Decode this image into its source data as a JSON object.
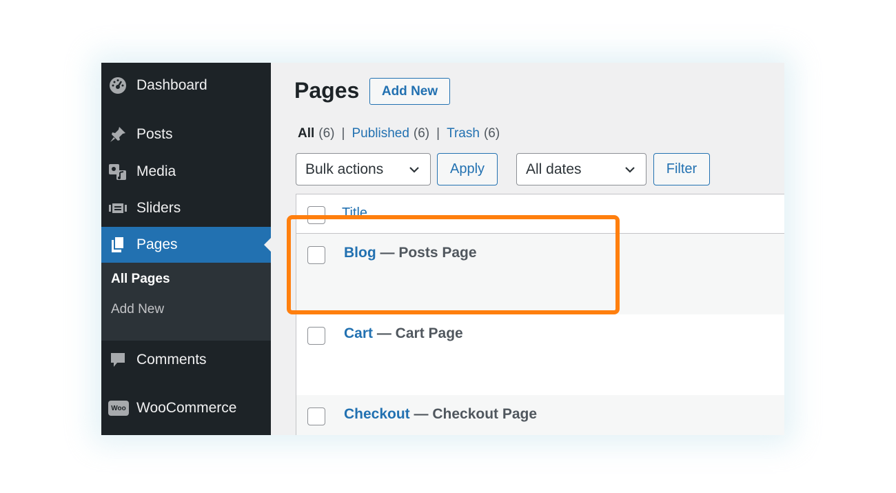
{
  "sidebar": {
    "items": [
      {
        "label": "Dashboard",
        "icon": "dashboard-icon"
      },
      {
        "label": "Posts",
        "icon": "pushpin-icon"
      },
      {
        "label": "Media",
        "icon": "media-icon"
      },
      {
        "label": "Sliders",
        "icon": "sliders-icon"
      },
      {
        "label": "Pages",
        "icon": "pages-icon"
      },
      {
        "label": "Comments",
        "icon": "comment-icon"
      },
      {
        "label": "WooCommerce",
        "icon": "woocommerce-icon"
      }
    ],
    "submenu": [
      "All Pages",
      "Add New"
    ],
    "woo_badge": "Woo"
  },
  "header": {
    "title": "Pages",
    "add_new_label": "Add New"
  },
  "filters": {
    "views": [
      {
        "label": "All",
        "count": "(6)"
      },
      {
        "label": "Published",
        "count": "(6)"
      },
      {
        "label": "Trash",
        "count": "(6)"
      }
    ],
    "separator": "|",
    "bulk_actions": "Bulk actions",
    "apply_label": "Apply",
    "dates": "All dates",
    "filter_label": "Filter"
  },
  "table": {
    "column_title": "Title",
    "rows": [
      {
        "title": "Blog",
        "state": " — Posts Page"
      },
      {
        "title": "Cart",
        "state": " — Cart Page"
      },
      {
        "title": "Checkout",
        "state": " — Checkout Page"
      }
    ]
  },
  "colors": {
    "sidebar_bg": "#1d2327",
    "accent": "#2271b1",
    "highlight": "#ff7f0e"
  }
}
